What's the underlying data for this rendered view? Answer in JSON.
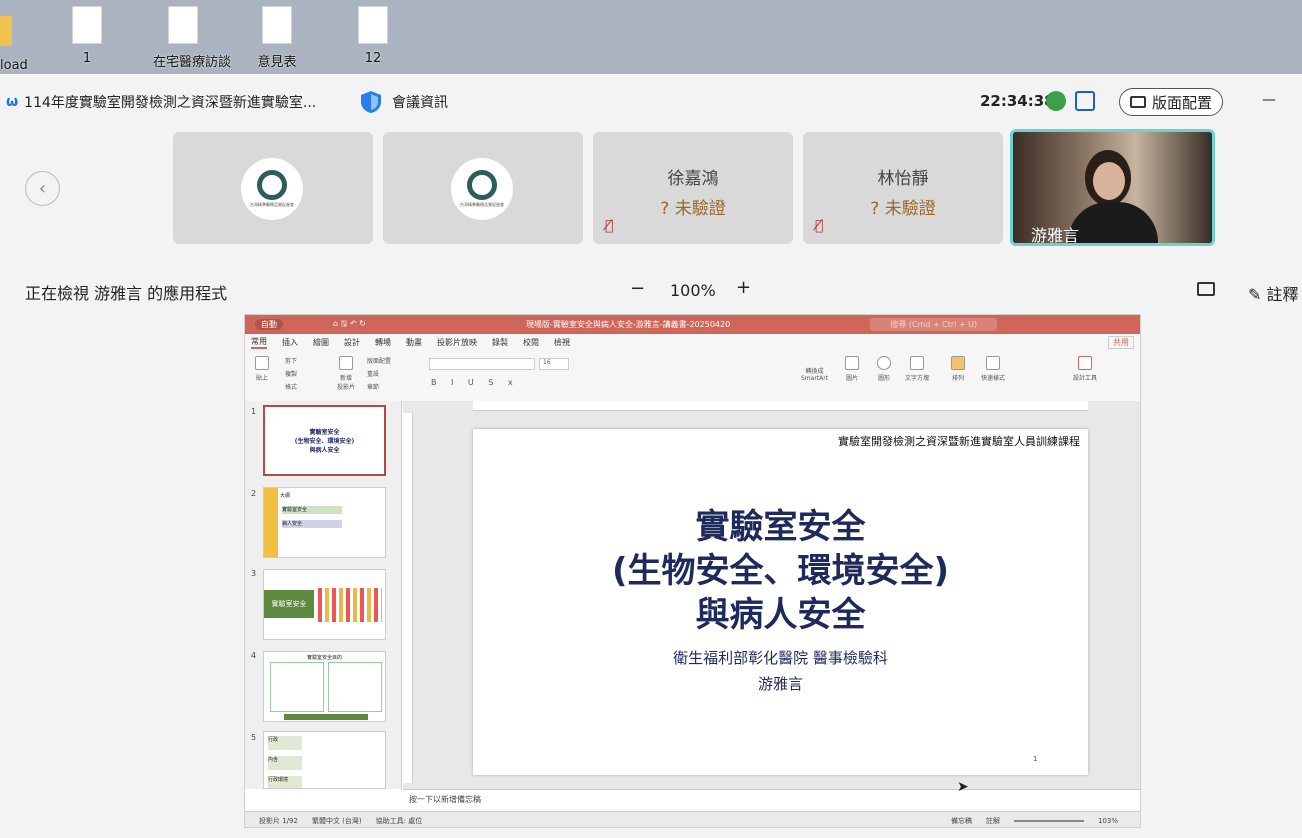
{
  "desktop": {
    "icons": [
      {
        "label": "load"
      },
      {
        "label": "1"
      },
      {
        "label": "在宅醫療訪談"
      },
      {
        "label": "意見表"
      },
      {
        "label": "12"
      }
    ]
  },
  "meeting": {
    "title": "114年度實驗室開發檢測之資深暨新進實驗室...",
    "info_label": "會議資訊",
    "time": "22:34:38",
    "layout_label": "版面配置",
    "minimize": "—"
  },
  "participants": [
    {
      "name": "",
      "type": "logo"
    },
    {
      "name": "",
      "type": "logo"
    },
    {
      "name": "徐嘉鴻",
      "status": "未驗證"
    },
    {
      "name": "林怡靜",
      "status": "未驗證"
    },
    {
      "name": "游雅言",
      "type": "video"
    }
  ],
  "share": {
    "viewing_text": "正在檢視 游雅言 的應用程式",
    "zoom": "100%",
    "minus": "−",
    "plus": "+",
    "annotate_label": "註釋"
  },
  "ppt": {
    "autosave": "自動",
    "file_title": "現場版-實驗室安全與病人安全-游雅言-講義書-20250420",
    "search": "搜尋 (Cmd + Ctrl + U)",
    "share_btn": "共用",
    "menu": [
      "常用",
      "插入",
      "繪圖",
      "設計",
      "轉場",
      "動畫",
      "投影片放映",
      "錄製",
      "校閱",
      "檢視"
    ],
    "ribbon": {
      "paste": "貼上",
      "cut": "剪下",
      "copy": "複製",
      "format": "格式",
      "new_slide": "新增\n投影片",
      "layout": "版面配置",
      "reset": "重設",
      "section": "章節",
      "font_size": "16",
      "smartart": "轉換成\nSmartArt",
      "picture": "圖片",
      "shape": "圖形",
      "textbox": "文字方塊",
      "arrange": "排列",
      "quick_styles": "快速樣式",
      "designer": "設計工具"
    },
    "thumbs": [
      {
        "num": "1",
        "title": "實驗室安全\n(生物安全、環境安全)\n與病人安全"
      },
      {
        "num": "2",
        "title": "大綱",
        "items": [
          "實驗室安全",
          "病人安全"
        ]
      },
      {
        "num": "3",
        "title": "實驗室安全"
      },
      {
        "num": "4",
        "title": "實驗室安全目的"
      },
      {
        "num": "5",
        "items": [
          "行政",
          "內含",
          "行政環境"
        ]
      }
    ],
    "slide": {
      "header": "實驗室開發檢測之資深暨新進實驗室人員訓練課程",
      "title1": "實驗室安全",
      "title2": "(生物安全、環境安全)",
      "title3": "與病人安全",
      "subtitle": "衛生福利部彰化醫院 醫事檢驗科",
      "author": "游雅言",
      "page": "1"
    },
    "notes_placeholder": "按一下以新增備忘稿",
    "status": {
      "slide": "投影片 1/92",
      "lang": "繁體中文 (台灣)",
      "access": "協助工具: 處位",
      "notes": "備忘稿",
      "comments": "註解",
      "zoom": "103%"
    }
  },
  "colors": {
    "accent": "#d0665a",
    "slide_title": "#1f2a5c",
    "brand": "#2f5d57"
  }
}
